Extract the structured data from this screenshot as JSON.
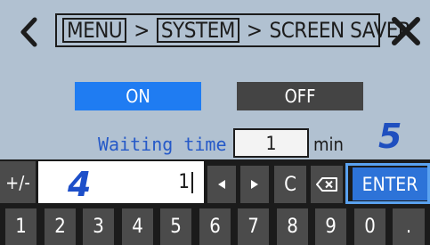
{
  "breadcrumb": {
    "items": [
      "MENU",
      "SYSTEM",
      "SCREEN SAVER"
    ],
    "separator": ">"
  },
  "icons": {
    "back": "chevron-left-icon",
    "close": "close-x-icon",
    "left_arrow": "triangle-left-icon",
    "right_arrow": "triangle-right-icon",
    "backspace": "backspace-icon"
  },
  "toggle": {
    "on_label": "ON",
    "off_label": "OFF",
    "selected": "ON"
  },
  "waiting_time": {
    "label": "Waiting time",
    "value": "1",
    "unit": "min"
  },
  "callouts": {
    "enter_step": "5",
    "input_step": "4"
  },
  "keypad": {
    "sign_label": "+/-",
    "input_value": "1",
    "clear_label": "C",
    "enter_label": "ENTER",
    "digits": [
      "1",
      "2",
      "3",
      "4",
      "5",
      "6",
      "7",
      "8",
      "9",
      "0",
      "."
    ]
  },
  "colors": {
    "screen_bg": "#b1c1d1",
    "selected_blue": "#1f7cf2",
    "unselected_gray": "#444444",
    "label_blue": "#2559c8",
    "keypad_bg": "#1b1b1b",
    "key_gray": "#4b4b4b",
    "enter_blue": "#2d73d8",
    "callout_blue": "#1d4fc9"
  }
}
